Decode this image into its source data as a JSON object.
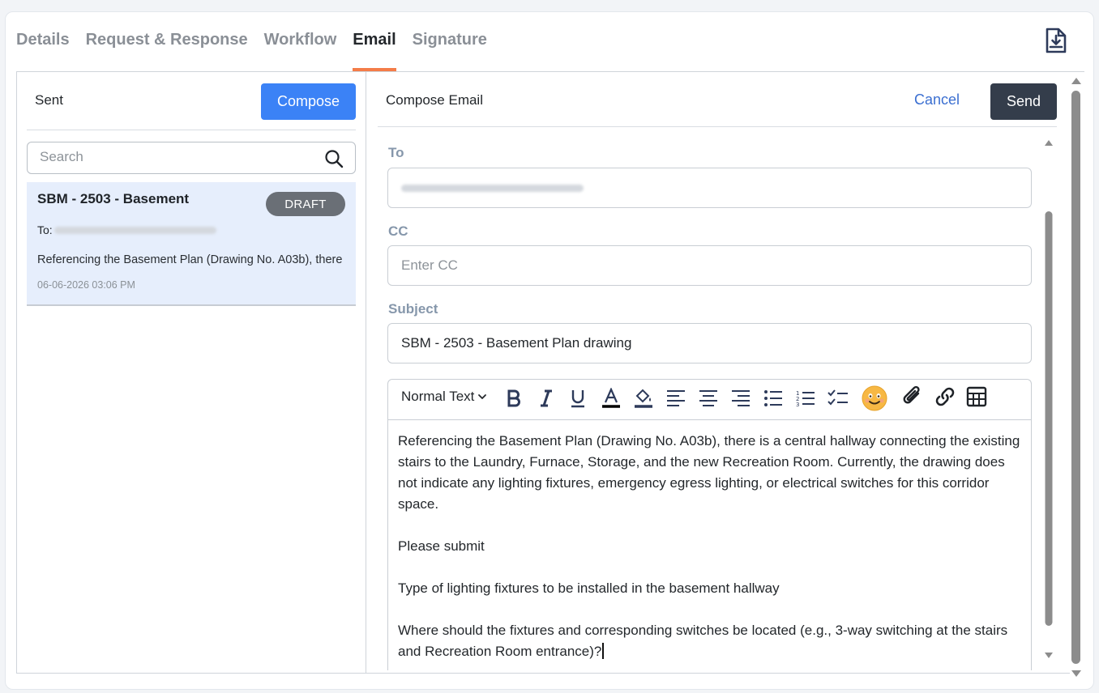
{
  "tabs": [
    {
      "label": "Details"
    },
    {
      "label": "Request & Response"
    },
    {
      "label": "Workflow"
    },
    {
      "label": "Email",
      "active": true
    },
    {
      "label": "Signature"
    }
  ],
  "sent_panel": {
    "title": "Sent",
    "compose_label": "Compose",
    "search_placeholder": "Search",
    "items": [
      {
        "subject": "SBM - 2503 - Basement",
        "badge": "DRAFT",
        "to_label": "To:",
        "preview": "Referencing the Basement Plan (Drawing No. A03b), there",
        "date": "06-06-2026 03:06 PM"
      }
    ]
  },
  "compose": {
    "title": "Compose Email",
    "cancel_label": "Cancel",
    "send_label": "Send",
    "to_label": "To",
    "cc_label": "CC",
    "cc_placeholder": "Enter CC",
    "subject_label": "Subject",
    "subject_value": "SBM - 2503 - Basement Plan drawing",
    "text_style": "Normal Text",
    "body": [
      "Referencing the Basement Plan (Drawing No. A03b), there is a central hallway connecting the existing stairs to the Laundry, Furnace, Storage, and the new Recreation Room. Currently, the drawing does not indicate any lighting fixtures, emergency egress lighting, or electrical switches for this corridor space.",
      "Please submit",
      "Type of lighting fixtures to be installed in the basement hallway",
      "Where should the fixtures and corresponding switches be located (e.g., 3-way switching at the stairs and Recreation Room entrance)?"
    ]
  },
  "colors": {
    "accent_tab": "#f47c48",
    "compose_button": "#3b82f6",
    "send_button": "#343d4b",
    "draft_badge": "#6a6f76",
    "selected_item_bg": "#e6eefc"
  },
  "icons": [
    "download-file-icon",
    "search-icon",
    "bold-icon",
    "italic-icon",
    "underline-icon",
    "text-color-icon",
    "highlight-icon",
    "align-left-icon",
    "align-center-icon",
    "align-right-icon",
    "bullet-list-icon",
    "numbered-list-icon",
    "checklist-icon",
    "emoji-icon",
    "attachment-icon",
    "link-icon",
    "table-icon"
  ]
}
